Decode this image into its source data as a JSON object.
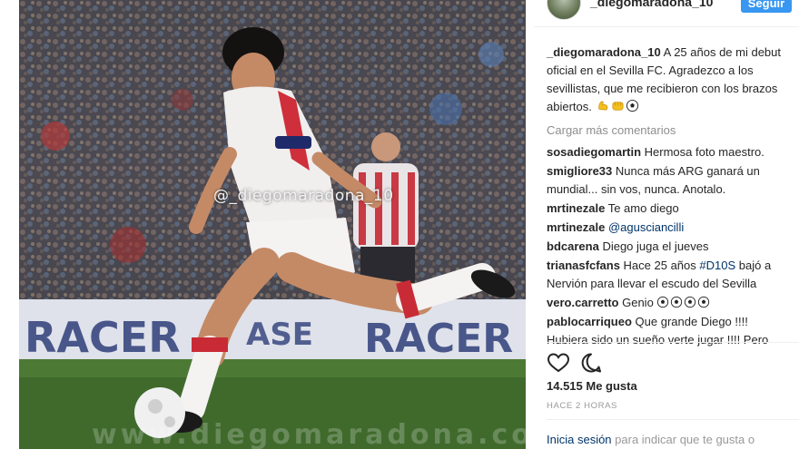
{
  "post": {
    "watermark": "@_diegomaradona_10",
    "bottom_watermark": "www.diegomaradona.com"
  },
  "header": {
    "username": "_diegomaradona_10",
    "follow_label": "Seguir"
  },
  "caption": {
    "username": "_diegomaradona_10",
    "text": "A 25 años de mi debut oficial en el Sevilla FC. Agradezco a los sevillistas, que me recibieron con los brazos abiertos.",
    "emojis": [
      "flexed-biceps-emoji",
      "fist-emoji",
      "soccer-ball-emoji"
    ]
  },
  "load_more_label": "Cargar más comentarios",
  "comments": [
    {
      "user": "sosadiegomartin",
      "text": "Hermosa foto maestro."
    },
    {
      "user": "smigliore33",
      "text": "Nunca más ARG ganará un mundial... sin vos, nunca. Anotalo."
    },
    {
      "user": "mrtinezale",
      "text": "Te amo diego"
    },
    {
      "user": "mrtinezale",
      "text": "@agusciancilli"
    },
    {
      "user": "bdcarena",
      "text": "Diego juga el jueves"
    },
    {
      "user": "trianasfcfans",
      "text_before": "Hace 25 años ",
      "hashtag": "#D10S",
      "text_after": " bajó a Nervión para llevar el escudo del Sevilla"
    },
    {
      "user": "vero.carretto",
      "text": "Genio",
      "balls": 4
    },
    {
      "user": "pablocarriqueo",
      "text": "Que grande Diego !!!! Hubiera sido un sueño verte jugar !!!! Pero"
    }
  ],
  "likes_label": "14.515 Me gusta",
  "time_label": "HACE 2 HORAS",
  "login": {
    "link": "Inicia sesión",
    "rest": " para indicar que te gusta o"
  },
  "colors": {
    "follow_button": "#3897f0",
    "link": "#003569",
    "muted": "#8e8e8e"
  }
}
